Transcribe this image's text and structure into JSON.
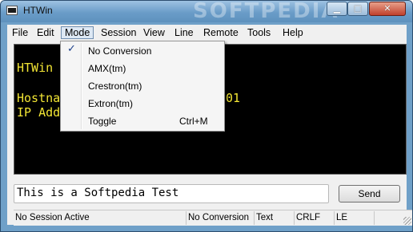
{
  "window": {
    "title": "HTWin",
    "watermark": "SOFTPEDIA",
    "minimize_glyph": "▁",
    "maximize_glyph": "□",
    "close_glyph": "✕"
  },
  "menubar": {
    "items": [
      "File",
      "Edit",
      "Mode",
      "Session",
      "View",
      "Line",
      "Remote",
      "Tools",
      "Help"
    ]
  },
  "mode_menu": {
    "check_glyph": "✓",
    "items": [
      {
        "label": "No Conversion",
        "checked": true
      },
      {
        "label": "AMX(tm)"
      },
      {
        "label": "Crestron(tm)"
      },
      {
        "label": "Extron(tm)"
      },
      {
        "label": "Toggle",
        "shortcut": "Ctrl+M"
      }
    ]
  },
  "console": {
    "lines": [
      "HTWin",
      "Hostna",
      "101",
      "IP Add"
    ]
  },
  "input": {
    "value": "This is a Softpedia Test"
  },
  "send_label": "Send",
  "statusbar": {
    "session": "No Session Active",
    "conversion": "No Conversion",
    "mode": "Text",
    "line_ending": "CRLF",
    "echo": "LE"
  },
  "colors": {
    "console_bg": "#000000",
    "console_text": "#f3e634",
    "titlebar": "#6a9cc8"
  }
}
